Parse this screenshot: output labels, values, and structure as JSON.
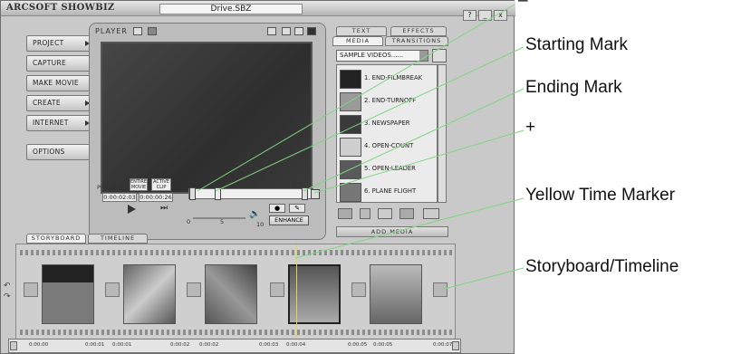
{
  "app": {
    "title": "ArcSoft ShowBiz",
    "document": "Drive.SBZ",
    "window_buttons": [
      "?",
      "_",
      "x"
    ]
  },
  "nav": {
    "items": [
      {
        "label": "Project",
        "arrow": true
      },
      {
        "label": "Capture",
        "arrow": false
      },
      {
        "label": "Make Movie",
        "arrow": false
      },
      {
        "label": "Create",
        "arrow": true
      },
      {
        "label": "Internet",
        "arrow": true
      }
    ],
    "options_label": "Options"
  },
  "player": {
    "label": "Player",
    "preview_label": "Preview:",
    "entire_movie_label": "Entire Movie",
    "active_clip_label": "Active Clip",
    "time_current": "0:00:02:03",
    "time_total": "0:00:00:26",
    "volume_min": "0",
    "volume_mid": "5",
    "volume_max": "10",
    "enhance_label": "Enhance"
  },
  "media": {
    "tabs": [
      "Text",
      "Effects",
      "Media",
      "Transitions"
    ],
    "dropdown_value": "Sample Videos......",
    "items": [
      {
        "label": "1. END-FILMBREAK"
      },
      {
        "label": "2. END-TURNOFF"
      },
      {
        "label": "3. NEWSPAPER"
      },
      {
        "label": "4. OPEN-COUNT"
      },
      {
        "label": "5. OPEN-LEADER"
      },
      {
        "label": "6. PLANE FLIGHT"
      }
    ],
    "add_media_label": "Add Media"
  },
  "storyboard": {
    "tabs": [
      "Storyboard",
      "Timeline"
    ]
  },
  "ruler": {
    "ticks": [
      "0:00:00",
      "0:00:01",
      "0:00:01",
      "0:00:02",
      "0:00:02",
      "0:00:03",
      "0:00:04",
      "0:00:05",
      "0:00:05",
      "0:00:07"
    ]
  },
  "annotations": {
    "minus": "–",
    "starting_mark": "Starting Mark",
    "ending_mark": "Ending Mark",
    "plus": "+",
    "yellow_time_marker": "Yellow Time Marker",
    "storyboard_timeline": "Storyboard/Timeline"
  },
  "colors": {
    "callout_line": "#7fd67f",
    "time_marker": "#e7d44a"
  }
}
